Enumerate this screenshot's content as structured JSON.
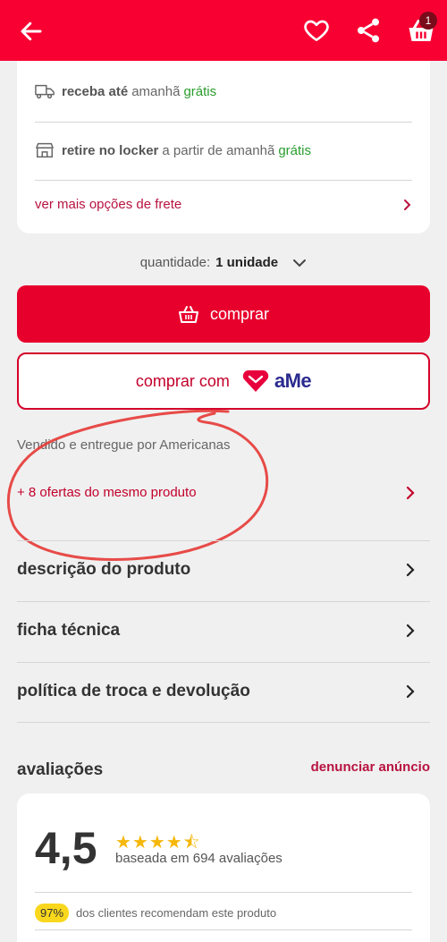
{
  "header": {
    "cart_count": "1",
    "icons": [
      "arrow-left-icon",
      "heart-icon",
      "share-icon",
      "basket-icon"
    ],
    "bg_color": "#f80032"
  },
  "shipping": {
    "row1": {
      "bold": "receba até",
      "muted": "amanhã",
      "free": "grátis"
    },
    "row2": {
      "bold": "retire no locker",
      "muted": "a partir de amanhã",
      "free": "grátis"
    },
    "more_options": "ver mais opções de frete"
  },
  "quantity": {
    "label": "quantidade:",
    "value": "1 unidade"
  },
  "buttons": {
    "buy": "comprar",
    "buy_with": "comprar com",
    "ame_brand": "aMe"
  },
  "seller": {
    "sold_by": "Vendido e entregue por Americanas",
    "offers": "+ 8 ofertas do mesmo produto"
  },
  "menu": [
    {
      "label": "descrição do produto"
    },
    {
      "label": "ficha técnica"
    },
    {
      "label": "política de troca e devolução"
    }
  ],
  "reviews": {
    "title": "avaliações",
    "report": "denunciar anúncio",
    "score": "4,5",
    "stars": "★★★★⯪",
    "based_on": "baseada em 694 avaliações",
    "percent": "97%",
    "recommend_text": "dos clientes recomendam este produto"
  },
  "colors": {
    "accent": "#e8002d",
    "link": "#b8123f",
    "green": "#2a9d2e",
    "star": "#f5b70a"
  }
}
